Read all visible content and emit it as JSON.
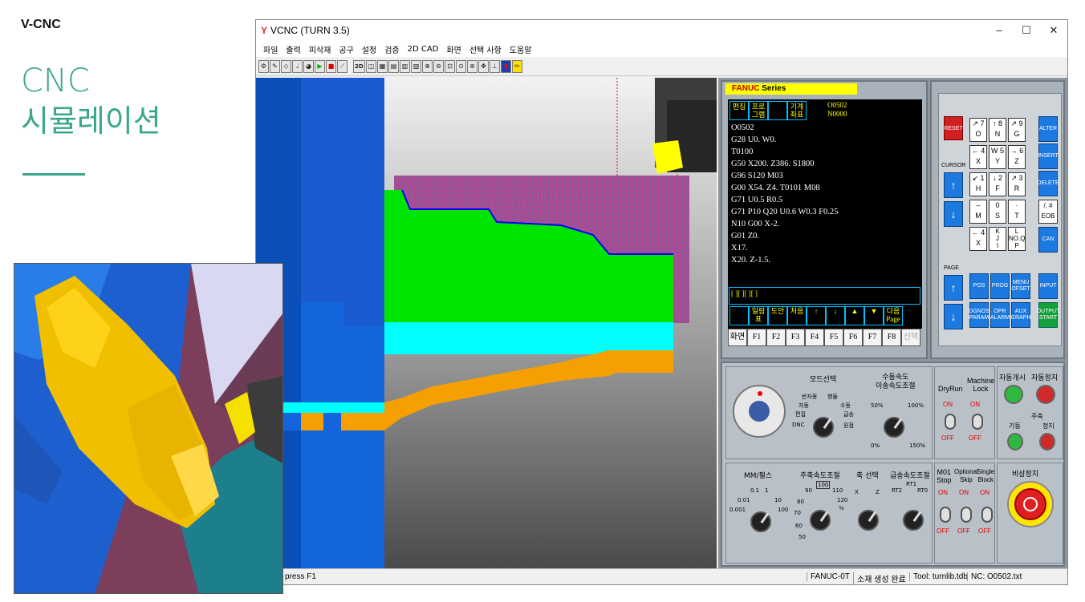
{
  "slide": {
    "brand": "V-CNC",
    "title_en": "CNC",
    "title_ko": "시뮬레이션"
  },
  "window": {
    "title": "VCNC (TURN 3.5)",
    "controls": [
      "–",
      "☐",
      "✕"
    ]
  },
  "menu": [
    "파일",
    "출력",
    "피삭재",
    "공구",
    "설정",
    "검증",
    "2D CAD",
    "화면",
    "선택 사항",
    "도움말"
  ],
  "toolbar": {
    "mode_label": "2D"
  },
  "status": {
    "hint": "press F1",
    "control": "FANUC-0T",
    "message": "소재 생성 완료",
    "tool": "Tool: turnlib.tdb",
    "nc": "NC: O0502.txt"
  },
  "fanuc": {
    "series_brand": "FANUC",
    "series_suffix": "Series",
    "tabs": [
      "편집",
      "프로그램",
      "",
      "기계좌표"
    ],
    "program_id": "O0502",
    "sequence": "N0000",
    "code_lines": [
      "O0502",
      "G28 U0. W0.",
      "T0100",
      "G50 X200. Z386. S1800",
      "G96 S120 M03",
      "G00 X54. Z4. T0101 M08",
      "G71 U0.5 R0.5",
      "G71 P10 Q20 U0.6 W0.3 F0.25",
      "N10 G00 X-2.",
      "G01 Z0.",
      "X17.",
      "X20. Z-1.5."
    ],
    "status_line": "[  ][  ][  ][  ]",
    "soft_labels": [
      "",
      "일람표",
      "도안",
      "처음",
      "↑",
      "↓",
      "▲",
      "▼",
      "다음Page"
    ],
    "fkeys": [
      "화면",
      "F1",
      "F2",
      "F3",
      "F4",
      "F5",
      "F6",
      "F7",
      "F8",
      "선택"
    ]
  },
  "keypad": {
    "reset": "RESET",
    "cursor": "CURSOR",
    "page": "PAGE",
    "alter": "ALTER",
    "insert": "INSERT",
    "delete": "DELETE",
    "eob": "/, #\nEOB",
    "can": "CAN",
    "input": "INPUT",
    "output_start": "OUTPUT\nSTART",
    "pos": "POS",
    "prog": "PROG",
    "menu_offset": "MENU\nOFSET",
    "dgnos_param": "DGNOS\nPARAM",
    "opr_alarm": "OPR\nALARM",
    "aux_graph": "AUX\nGRAPH",
    "keys": [
      {
        "label": "↗ 7\nO"
      },
      {
        "label": "↑ 8\nN"
      },
      {
        "label": "↗ 9\nG"
      },
      {
        "label": "← 4\nX"
      },
      {
        "label": "W 5\nY"
      },
      {
        "label": "→ 6\nZ"
      },
      {
        "label": "↙ 1\nH"
      },
      {
        "label": "↓ 2\nF"
      },
      {
        "label": "↗ 3\nR"
      },
      {
        "label": "–\nM"
      },
      {
        "label": "0\nS"
      },
      {
        "label": "·\nT"
      },
      {
        "label": "← 4\nX"
      },
      {
        "label": "K\nJ\nI"
      },
      {
        "label": "L\nNO.Q\nP"
      }
    ]
  },
  "operator": {
    "mode_select": "모드선택",
    "mode_labels": [
      "반자동",
      "핸들",
      "자동",
      "수동",
      "편집",
      "급송",
      "DNC",
      "원점"
    ],
    "jog_speed": "수동속도\n이송속도조절",
    "jog_ticks": [
      "50%",
      "100%",
      "0%",
      "150%"
    ],
    "dryrun": "DryRun",
    "machine_lock": "Machine\nLock",
    "on": "ON",
    "off": "OFF",
    "auto_start": "자동개시",
    "auto_stop": "자동정지",
    "spindle": "주축",
    "spindle_start": "기동",
    "spindle_stop": "정지",
    "mm_pulse": "MM/펄스",
    "mm_ticks": [
      "0.1",
      "1",
      "0.01",
      "10",
      "0.001",
      "100"
    ],
    "spindle_speed": "주축속도조절",
    "spindle_ticks": [
      "100",
      "90",
      "110",
      "80",
      "120",
      "70",
      "%",
      "60",
      "50"
    ],
    "axis_select": "축 선택",
    "axis_ticks": [
      "X",
      "Z"
    ],
    "rapid": "급송속도조절",
    "rapid_ticks": [
      "RT2",
      "RT1",
      "RT0"
    ],
    "m01_stop": "M01\nStop",
    "optional_skip": "Optional\nSkip",
    "single_block": "Single\nBlock",
    "emergency": "비상정지"
  }
}
